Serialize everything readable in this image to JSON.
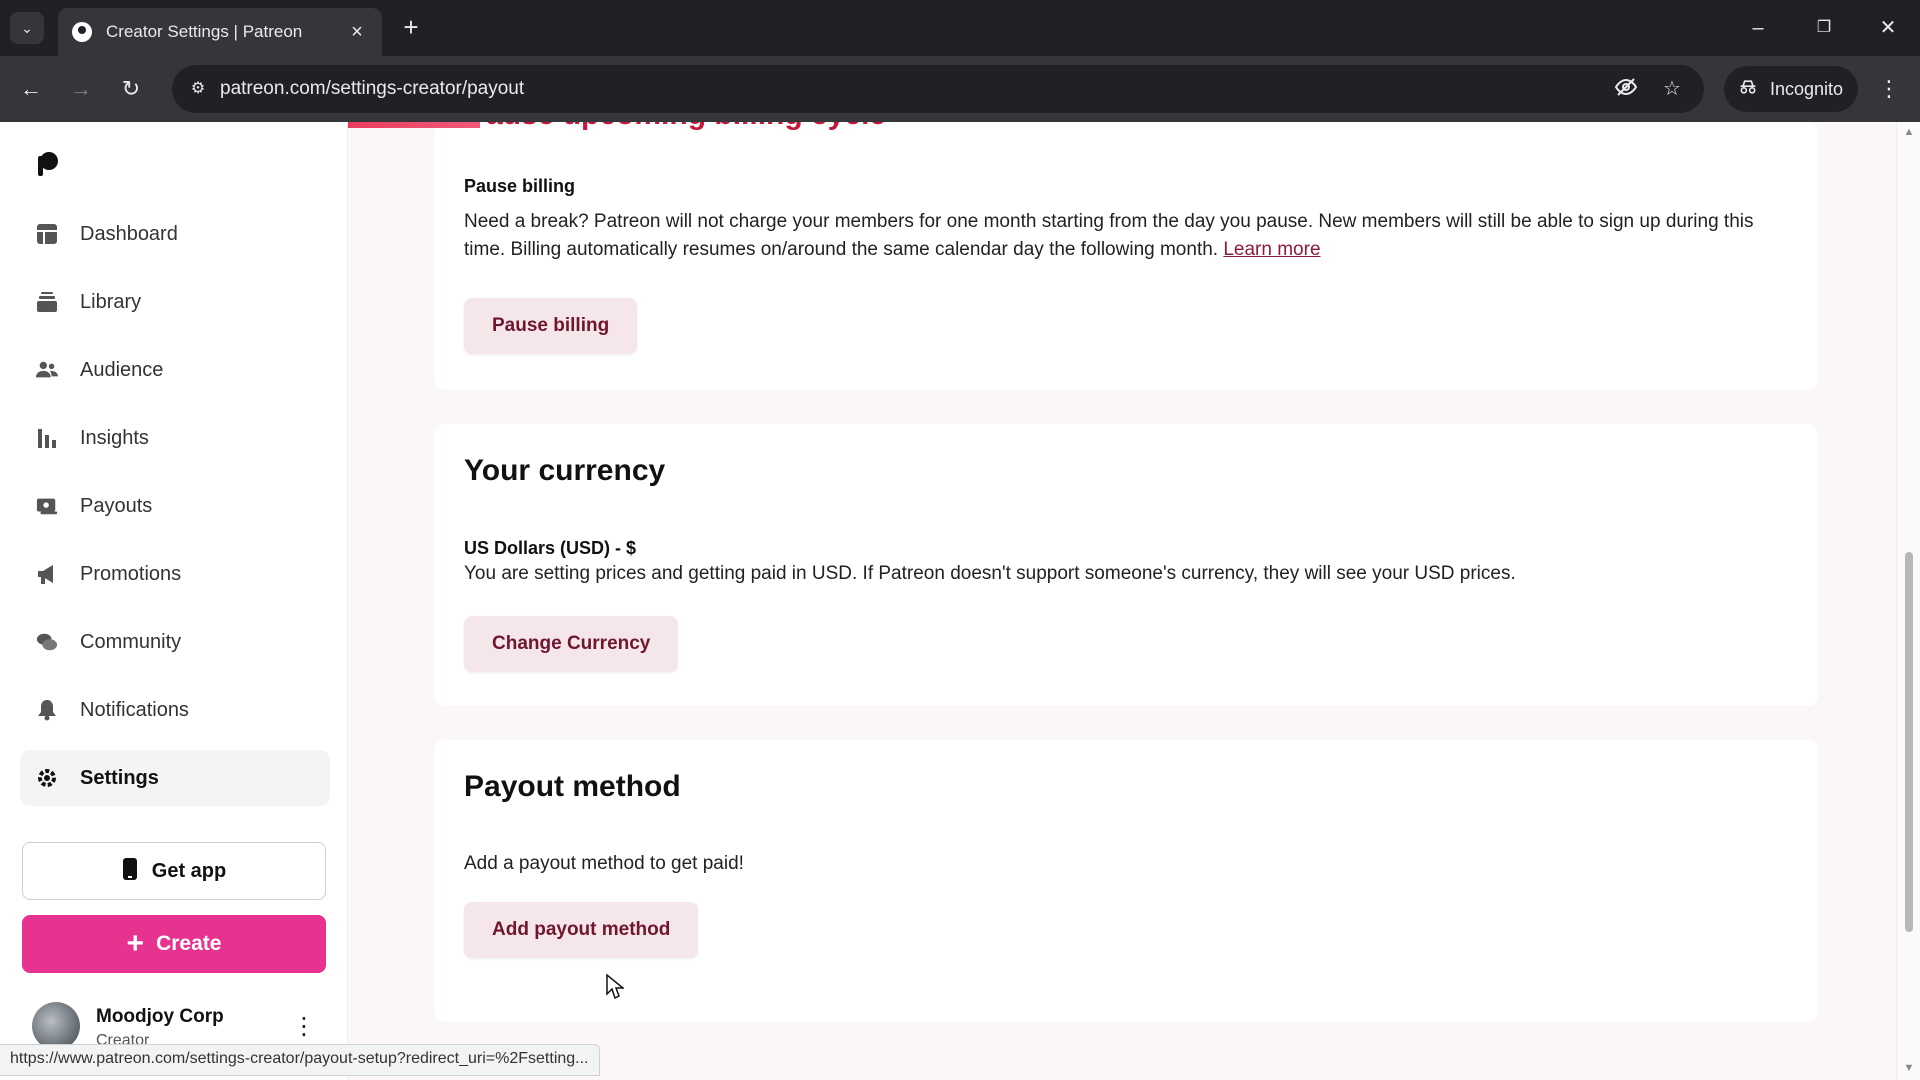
{
  "browser": {
    "tab_title": "Creator Settings | Patreon",
    "url": "patreon.com/settings-creator/payout",
    "incognito_label": "Incognito",
    "status_url": "https://www.patreon.com/settings-creator/payout-setup?redirect_uri=%2Fsetting..."
  },
  "sidebar": {
    "items": [
      {
        "label": "Dashboard",
        "icon": "dashboard-icon"
      },
      {
        "label": "Library",
        "icon": "library-icon"
      },
      {
        "label": "Audience",
        "icon": "audience-icon"
      },
      {
        "label": "Insights",
        "icon": "insights-icon"
      },
      {
        "label": "Payouts",
        "icon": "payouts-icon"
      },
      {
        "label": "Promotions",
        "icon": "megaphone-icon"
      },
      {
        "label": "Community",
        "icon": "chat-bubbles-icon"
      },
      {
        "label": "Notifications",
        "icon": "bell-icon"
      },
      {
        "label": "Settings",
        "icon": "gear-icon",
        "active": true
      }
    ],
    "get_app_label": "Get app",
    "create_label": "Create",
    "profile": {
      "name": "Moodjoy Corp",
      "role": "Creator"
    }
  },
  "main": {
    "pause_section": {
      "cut_heading": "Pause upcoming billing cycle",
      "subtitle": "Pause billing",
      "text": "Need a break? Patreon will not charge your members for one month starting from the day you pause. New members will still be able to sign up during this time. Billing automatically resumes on/around the same calendar day the following month.",
      "link": "Learn more",
      "button": "Pause billing"
    },
    "currency_section": {
      "title": "Your currency",
      "currency_name": "US Dollars (USD) - $",
      "text": "You are setting prices and getting paid in USD. If Patreon doesn't support someone's currency, they will see your USD prices.",
      "button": "Change Currency"
    },
    "payout_section": {
      "title": "Payout method",
      "text": "Add a payout method to get paid!",
      "button": "Add payout method"
    }
  },
  "colors": {
    "brand_pink": "#e7338f",
    "button_tint": "#f5e6ea",
    "button_text": "#6f1630",
    "link": "#8c1b3c"
  }
}
